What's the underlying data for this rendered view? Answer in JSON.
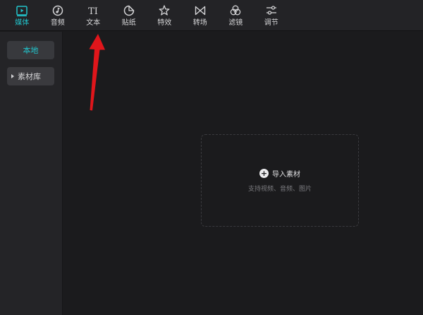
{
  "toolbar": {
    "items": [
      {
        "label": "媒体",
        "icon": "media-play-icon",
        "active": true
      },
      {
        "label": "音频",
        "icon": "audio-note-icon",
        "active": false
      },
      {
        "label": "文本",
        "icon": "text-ti-icon",
        "active": false
      },
      {
        "label": "贴纸",
        "icon": "sticker-icon",
        "active": false
      },
      {
        "label": "特效",
        "icon": "effects-star-icon",
        "active": false
      },
      {
        "label": "转场",
        "icon": "transition-bowtie-icon",
        "active": false
      },
      {
        "label": "滤镜",
        "icon": "filter-circles-icon",
        "active": false
      },
      {
        "label": "调节",
        "icon": "adjust-sliders-icon",
        "active": false
      }
    ],
    "text_glyph": "TI"
  },
  "sidebar": {
    "local_label": "本地",
    "library_label": "素材库"
  },
  "dropzone": {
    "import_label": "导入素材",
    "hint": "支持视频、音频、图片"
  },
  "colors": {
    "accent": "#22c4cc",
    "arrow": "#e0161b"
  }
}
